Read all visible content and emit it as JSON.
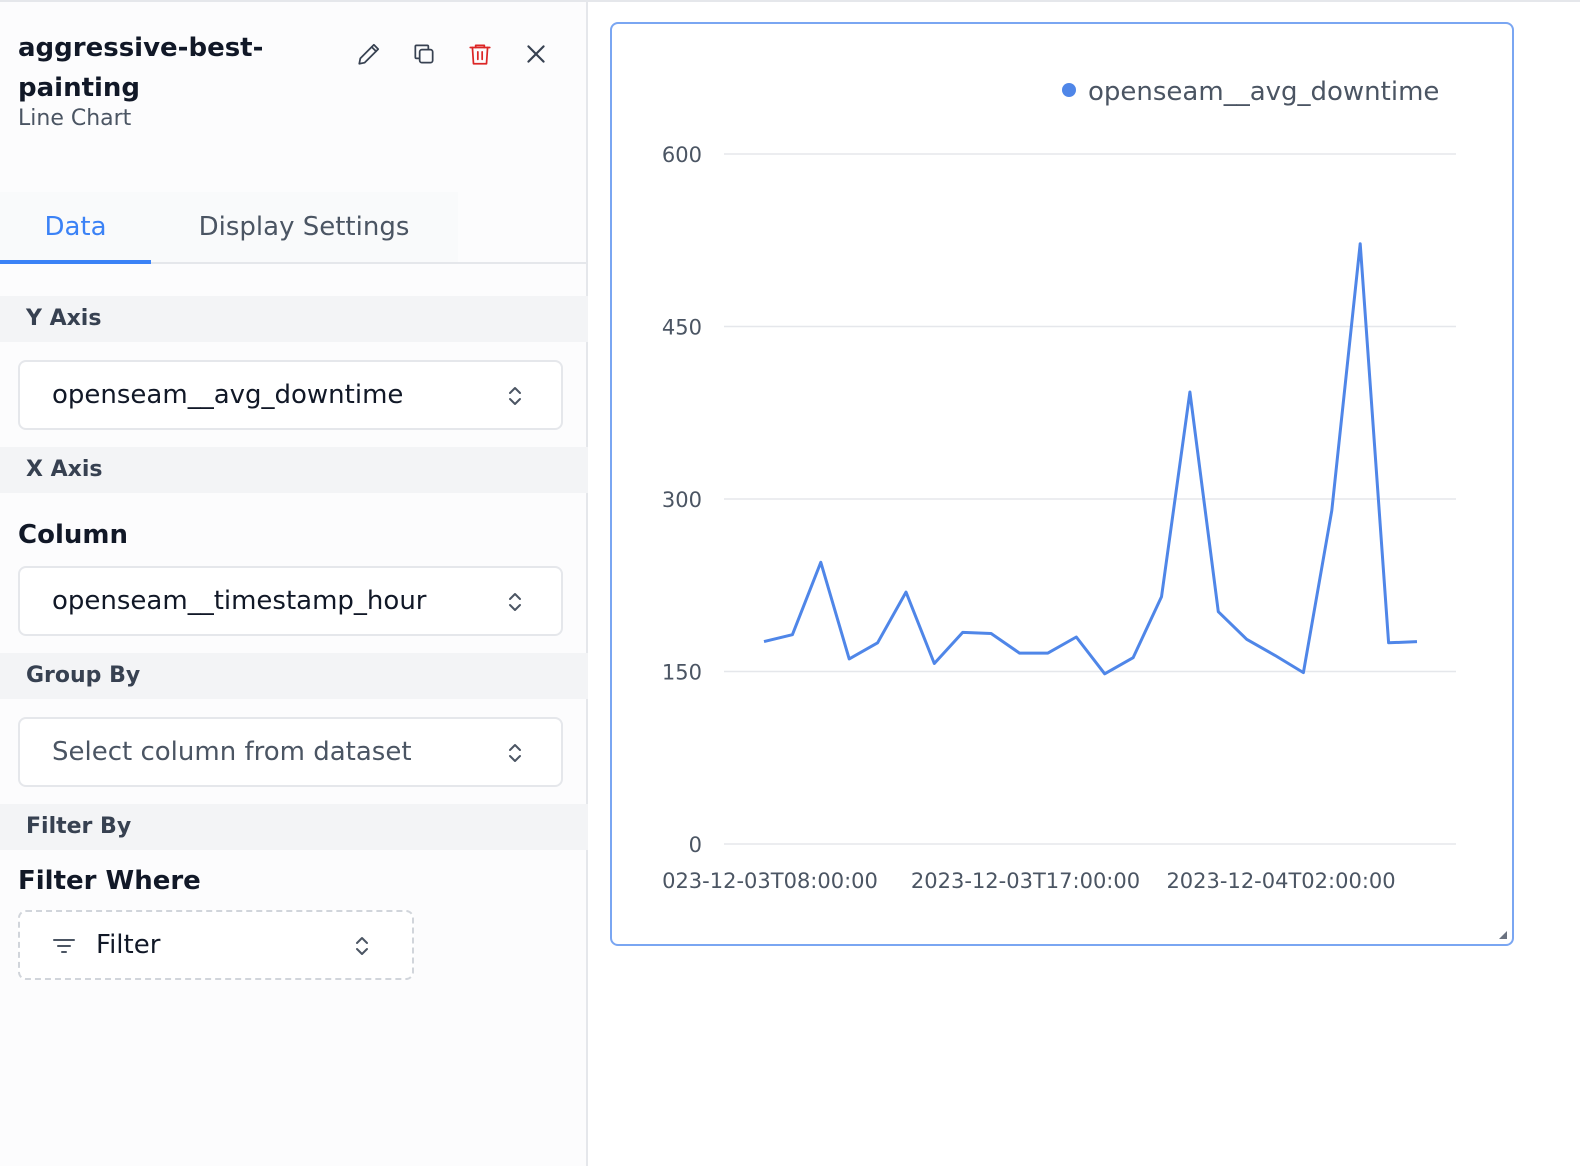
{
  "panel": {
    "title": "aggressive-best-painting",
    "subtitle": "Line Chart",
    "actions": {
      "edit_icon": "pencil-icon",
      "duplicate_icon": "copy-icon",
      "delete_icon": "trash-icon",
      "close_icon": "close-icon"
    },
    "tabs": [
      {
        "label": "Data",
        "active": true
      },
      {
        "label": "Display Settings",
        "active": false
      }
    ],
    "y_axis": {
      "header": "Y Axis",
      "value": "openseam__avg_downtime"
    },
    "x_axis": {
      "header": "X Axis",
      "column_label": "Column",
      "value": "openseam__timestamp_hour"
    },
    "group_by": {
      "header": "Group By",
      "placeholder": "Select column from dataset"
    },
    "filter_by": {
      "header": "Filter By",
      "label": "Filter Where",
      "button": "Filter"
    }
  },
  "colors": {
    "accent": "#3b82f6",
    "line": "#4f86e8",
    "delete": "#dc2626"
  },
  "chart_data": {
    "type": "line",
    "legend": [
      "openseam__avg_downtime"
    ],
    "legend_position": "top-right",
    "grid": true,
    "ylim": [
      0,
      600
    ],
    "yticks": [
      0,
      150,
      300,
      450,
      600
    ],
    "xtick_labels": [
      "023-12-03T08:00:00",
      "2023-12-03T17:00:00",
      "2023-12-04T02:00:00"
    ],
    "series": [
      {
        "name": "openseam__avg_downtime",
        "values": [
          176,
          182,
          245,
          161,
          175,
          219,
          157,
          184,
          183,
          166,
          166,
          180,
          148,
          162,
          215,
          393,
          202,
          178,
          164,
          149,
          290,
          522,
          175,
          176
        ]
      }
    ]
  }
}
